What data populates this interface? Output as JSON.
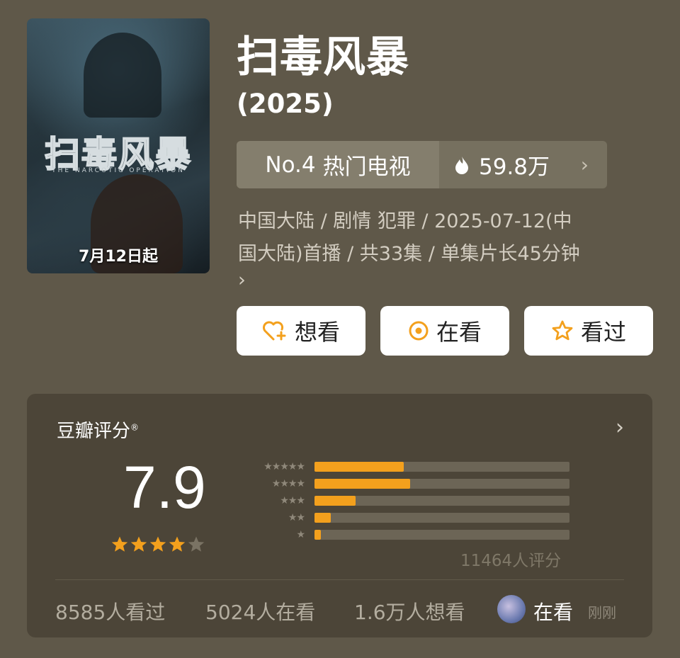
{
  "poster": {
    "title_art": "扫毒风暴",
    "subtitle_art": "THE NARCOTIC OPERATION",
    "date_text": "7月12日起"
  },
  "title": "扫毒风暴",
  "year": "(2025)",
  "rank": {
    "number": "No.4",
    "category": "热门电视",
    "heat": "59.8万",
    "heat_icon": "flame-icon"
  },
  "meta": {
    "line1": "中国大陆 / 剧情 犯罪 / 2025-07-12(中",
    "line2": "国大陆)首播 / 共33集 / 单集片长45分钟",
    "more_icon": "›"
  },
  "actions": {
    "want": "想看",
    "doing": "在看",
    "done": "看过"
  },
  "rating": {
    "label": "豆瓣评分",
    "mark": "®",
    "score": "7.9",
    "stars_filled": 4,
    "stars_total": 5,
    "distribution": [
      {
        "stars": "★★★★★",
        "fraction": 0.35
      },
      {
        "stars": "★★★★",
        "fraction": 0.375
      },
      {
        "stars": "★★★",
        "fraction": 0.16
      },
      {
        "stars": "★★",
        "fraction": 0.065
      },
      {
        "stars": "★",
        "fraction": 0.025
      }
    ],
    "count_text": "11464人评分"
  },
  "stats": {
    "watched": "8585人看过",
    "watching": "5024人在看",
    "wish": "1.6万人想看"
  },
  "friend": {
    "status": "在看",
    "time": "刚刚"
  },
  "colors": {
    "background": "#5f5849",
    "accent": "#f3a01d",
    "panel": "#4c4538"
  }
}
